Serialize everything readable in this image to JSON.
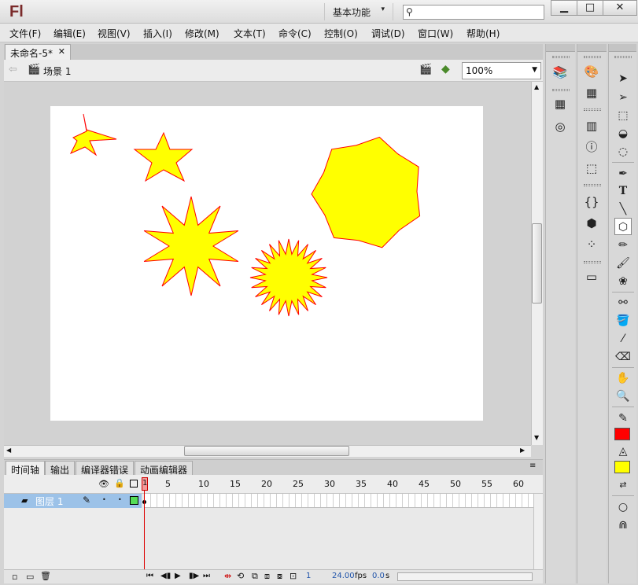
{
  "app": {
    "logo": "Fl",
    "workspace": "基本功能",
    "search_placeholder": "",
    "win_minimize": "▁",
    "win_maximize": "□",
    "win_close": "✕"
  },
  "menubar": [
    {
      "label": "文件(F)"
    },
    {
      "label": "编辑(E)"
    },
    {
      "label": "视图(V)"
    },
    {
      "label": "插入(I)"
    },
    {
      "label": "修改(M)"
    },
    {
      "label": "文本(T)"
    },
    {
      "label": "命令(C)"
    },
    {
      "label": "控制(O)"
    },
    {
      "label": "调试(D)"
    },
    {
      "label": "窗口(W)"
    },
    {
      "label": "帮助(H)"
    }
  ],
  "document": {
    "tab_title": "未命名-5*",
    "scene": "场景 1",
    "zoom": "100%"
  },
  "stage": {
    "background": "#ffffff",
    "shape_fill": "#ffff00",
    "shape_stroke": "#ff0000"
  },
  "timeline": {
    "tabs": [
      "时间轴",
      "输出",
      "编译器错误",
      "动画编辑器"
    ],
    "frame_numbers": [
      "1",
      "5",
      "10",
      "15",
      "20",
      "25",
      "30",
      "35",
      "40",
      "45",
      "50",
      "55",
      "60"
    ],
    "layer_name": "图层 1",
    "current_frame": "1",
    "fps": "24.00",
    "fps_unit": "fps",
    "time": "0.0",
    "time_unit": "s"
  },
  "toolbox": {
    "stroke_color": "#ff0000",
    "fill_color": "#ffff00"
  },
  "icons": {
    "library": "library-icon",
    "color": "color-icon",
    "swatches": "swatches-icon",
    "align": "align-icon",
    "info": "info-icon",
    "transform": "transform-icon"
  }
}
